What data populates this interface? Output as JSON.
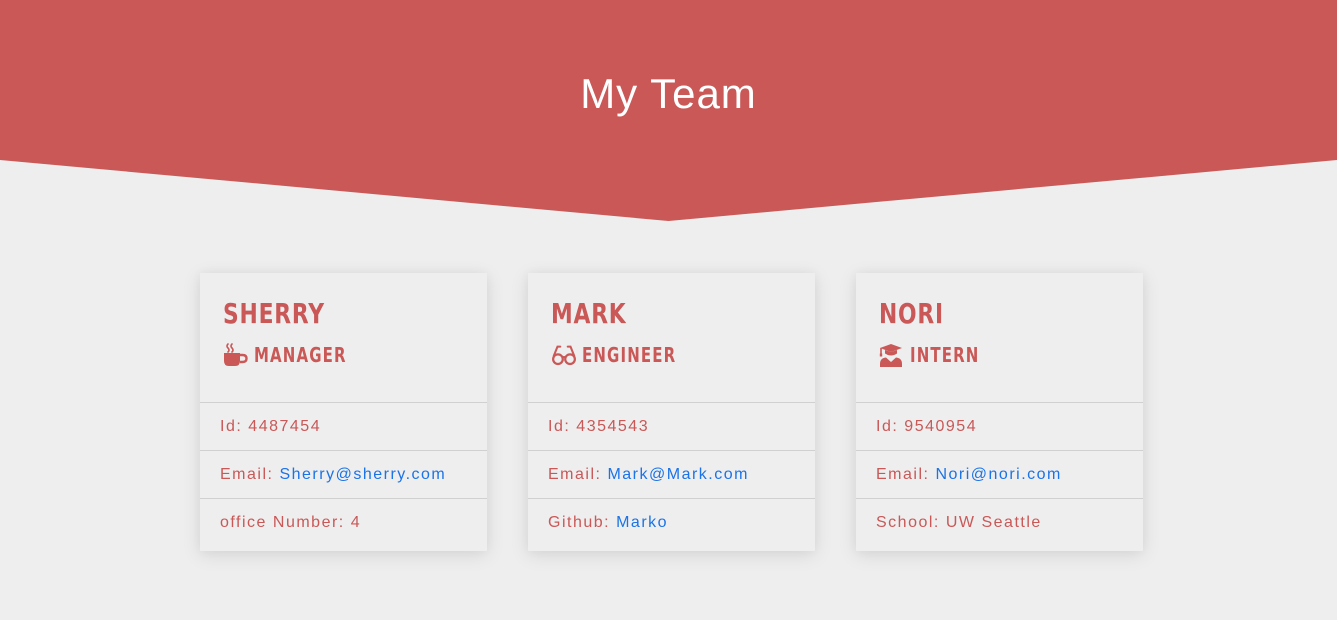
{
  "header": {
    "title": "My Team"
  },
  "colors": {
    "accent": "#c95857",
    "link": "#1a73e8",
    "background": "#eeeeee"
  },
  "cards": [
    {
      "name": "Sherry",
      "role": "Manager",
      "role_icon": "coffee-mug-icon",
      "id_label": "Id:",
      "id_value": "4487454",
      "email_label": "Email:",
      "email_value": "Sherry@sherry.com",
      "extra_label": "office Number:",
      "extra_value": "4"
    },
    {
      "name": "Mark",
      "role": "Engineer",
      "role_icon": "glasses-icon",
      "id_label": "Id:",
      "id_value": "4354543",
      "email_label": "Email:",
      "email_value": "Mark@Mark.com",
      "extra_label": "Github:",
      "extra_value": "Marko"
    },
    {
      "name": "Nori",
      "role": "Intern",
      "role_icon": "graduate-icon",
      "id_label": "Id:",
      "id_value": "9540954",
      "email_label": "Email:",
      "email_value": "Nori@nori.com",
      "extra_label": "School:",
      "extra_value": "UW Seattle"
    }
  ]
}
